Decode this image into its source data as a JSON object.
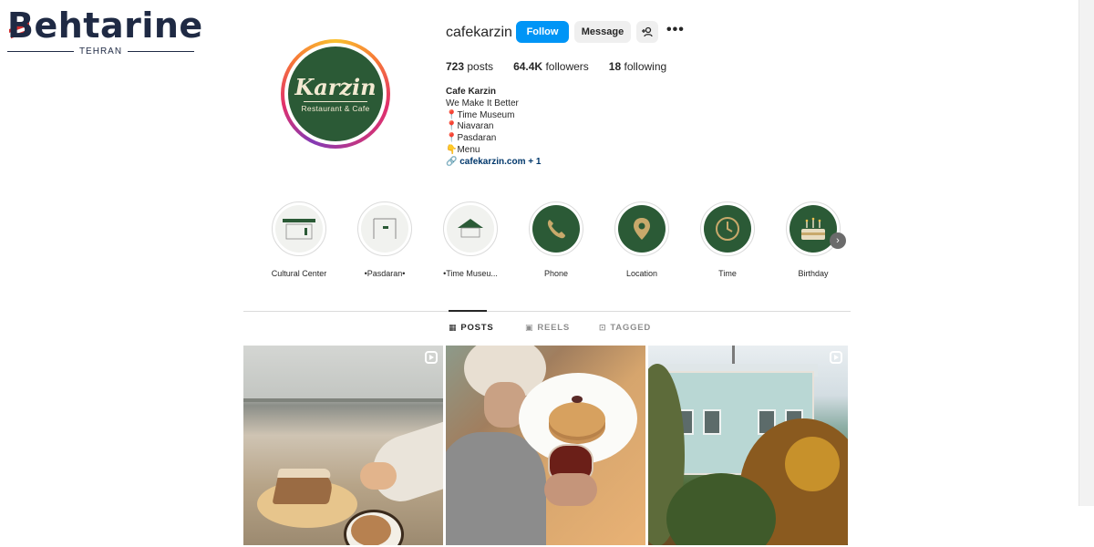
{
  "watermark": {
    "word": "Behtarine",
    "city": "TEHRAN"
  },
  "profile": {
    "username": "cafekarzin",
    "avatar_logo": {
      "word": "Karzin",
      "sub": "Restaurant & Cafe"
    },
    "actions": {
      "follow": "Follow",
      "message": "Message",
      "add_user_icon": "add-user-icon",
      "more": "•••"
    },
    "stats": {
      "posts_count": "723",
      "posts_label": "posts",
      "followers_count": "64.4K",
      "followers_label": "followers",
      "following_count": "18",
      "following_label": "following"
    },
    "bio": {
      "name": "Cafe Karzin",
      "lines": [
        "We Make It Better",
        "Time Museum",
        "Niavaran",
        "Pasdaran",
        "Menu"
      ],
      "link": "cafekarzin.com",
      "link_extra": "+ 1"
    }
  },
  "highlights": [
    {
      "label": "Cultural Center",
      "style": "light"
    },
    {
      "label": "•Pasdaran•",
      "style": "light"
    },
    {
      "label": "•Time Museu...",
      "style": "light"
    },
    {
      "label": "Phone",
      "style": "dark",
      "icon": "phone-icon"
    },
    {
      "label": "Location",
      "style": "dark",
      "icon": "location-pin-icon"
    },
    {
      "label": "Time",
      "style": "dark",
      "icon": "clock-icon"
    },
    {
      "label": "Birthday",
      "style": "dark",
      "icon": "cake-icon"
    }
  ],
  "tabs": [
    {
      "label": "POSTS",
      "icon": "grid-icon",
      "active": true
    },
    {
      "label": "REELS",
      "icon": "reels-icon",
      "active": false
    },
    {
      "label": "TAGGED",
      "icon": "tag-icon",
      "active": false
    }
  ],
  "posts": [
    {
      "type": "reel",
      "subject": "cake and latte"
    },
    {
      "type": "photo",
      "subject": "pancakes and tea"
    },
    {
      "type": "reel",
      "subject": "historic building in autumn"
    }
  ],
  "colors": {
    "follow_blue": "#0095f6",
    "brand_green": "#2b5a36",
    "link": "#00376b"
  }
}
